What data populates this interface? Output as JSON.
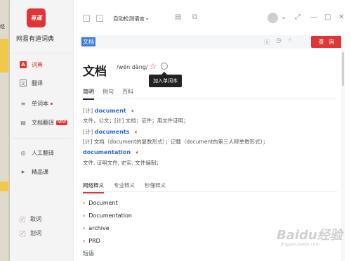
{
  "background": {
    "left_label": "经"
  },
  "app": {
    "logo_text": "有道",
    "name": "网易有道词典"
  },
  "sidebar": {
    "items": [
      {
        "label": "词典",
        "icon": "A"
      },
      {
        "label": "翻译",
        "icon": "文"
      },
      {
        "label": "单词本",
        "icon": "≡"
      },
      {
        "label": "文档翻译",
        "icon": "▤",
        "badge": "NEW"
      },
      {
        "label": "人工翻译",
        "icon": "◎"
      },
      {
        "label": "精品课",
        "icon": "▶"
      }
    ],
    "checks": [
      {
        "label": "取词",
        "mark": "✓"
      },
      {
        "label": "划词",
        "mark": "✓"
      }
    ]
  },
  "toolbar": {
    "back": "‹",
    "forward": "›",
    "language": "自动检测语言",
    "language_caret": "▾"
  },
  "window_controls": {
    "menu": "⌄",
    "swap": "⤢",
    "minimize": "—",
    "maximize": "□",
    "close": "✕"
  },
  "search": {
    "query": "文档"
  },
  "query_button": "查 询",
  "entry": {
    "word": "文档",
    "pinyin": "/wén dàng/",
    "tooltip": "加入单词本"
  },
  "tabs": [
    "简明",
    "例句",
    "百科"
  ],
  "definitions": [
    {
      "tag": "[计]",
      "word": "document",
      "meaning": "文件，公文；[计] 文档；证件；用文件证明；"
    },
    {
      "tag": "[计]",
      "word": "documents",
      "meaning": "[计] 文档（document的复数形式）；记载（document的第三人称单数形式）；"
    },
    {
      "tag": "",
      "word": "documentation",
      "meaning": "文件, 证明文件, 史实, 文件编制；"
    }
  ],
  "sub_tabs": [
    "网络释义",
    "专业释义",
    "秒懂释义"
  ],
  "web_meanings": [
    "Document",
    "Documentation",
    "archive",
    "PRD"
  ],
  "phrase_label": "短语",
  "watermark": {
    "main": "Baidu经验",
    "sub": "jingyan.baidu.com"
  },
  "colors": {
    "accent": "#e03536",
    "link": "#2a6acb",
    "selection": "#3c7cd9"
  }
}
